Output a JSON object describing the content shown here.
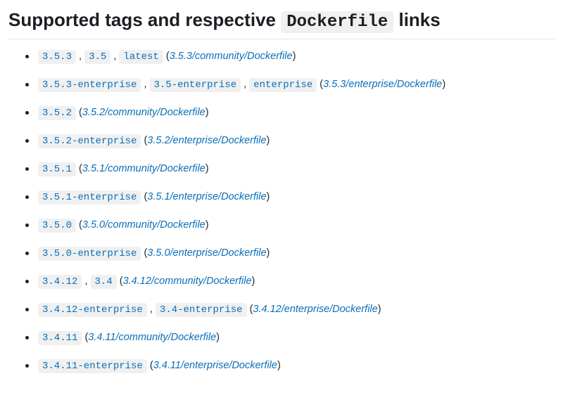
{
  "heading": {
    "before": "Supported tags and respective ",
    "code": "Dockerfile",
    "after": " links"
  },
  "items": [
    {
      "tags": [
        "3.5.3",
        "3.5",
        "latest"
      ],
      "dockerfile": "3.5.3/community/Dockerfile"
    },
    {
      "tags": [
        "3.5.3-enterprise",
        "3.5-enterprise",
        "enterprise"
      ],
      "dockerfile": "3.5.3/enterprise/Dockerfile"
    },
    {
      "tags": [
        "3.5.2"
      ],
      "dockerfile": "3.5.2/community/Dockerfile"
    },
    {
      "tags": [
        "3.5.2-enterprise"
      ],
      "dockerfile": "3.5.2/enterprise/Dockerfile"
    },
    {
      "tags": [
        "3.5.1"
      ],
      "dockerfile": "3.5.1/community/Dockerfile"
    },
    {
      "tags": [
        "3.5.1-enterprise"
      ],
      "dockerfile": "3.5.1/enterprise/Dockerfile"
    },
    {
      "tags": [
        "3.5.0"
      ],
      "dockerfile": "3.5.0/community/Dockerfile"
    },
    {
      "tags": [
        "3.5.0-enterprise"
      ],
      "dockerfile": "3.5.0/enterprise/Dockerfile"
    },
    {
      "tags": [
        "3.4.12",
        "3.4"
      ],
      "dockerfile": "3.4.12/community/Dockerfile"
    },
    {
      "tags": [
        "3.4.12-enterprise",
        "3.4-enterprise"
      ],
      "dockerfile": "3.4.12/enterprise/Dockerfile"
    },
    {
      "tags": [
        "3.4.11"
      ],
      "dockerfile": "3.4.11/community/Dockerfile"
    },
    {
      "tags": [
        "3.4.11-enterprise"
      ],
      "dockerfile": "3.4.11/enterprise/Dockerfile"
    }
  ]
}
